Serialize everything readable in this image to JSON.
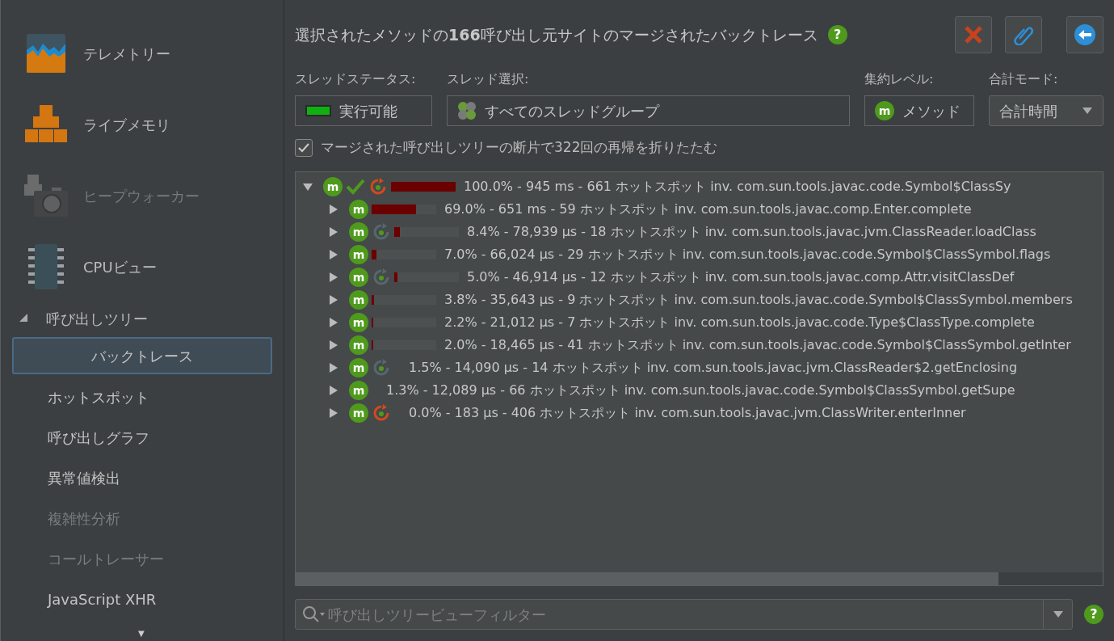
{
  "sidebar": {
    "modules": [
      {
        "kind": "telemetry",
        "label": "テレメトリー",
        "disabled": false
      },
      {
        "kind": "memory",
        "label": "ライブメモリ",
        "disabled": false
      },
      {
        "kind": "heap",
        "label": "ヒープウォーカー",
        "disabled": true
      },
      {
        "kind": "cpu",
        "label": "CPUビュー",
        "disabled": false
      }
    ],
    "section": {
      "label": "呼び出しツリー",
      "expanded": true,
      "items": [
        {
          "label": "バックトレース",
          "selected": true,
          "disabled": false
        },
        {
          "label": "ホットスポット",
          "selected": false,
          "disabled": false
        },
        {
          "label": "呼び出しグラフ",
          "selected": false,
          "disabled": false
        },
        {
          "label": "異常値検出",
          "selected": false,
          "disabled": false
        },
        {
          "label": "複雑性分析",
          "selected": false,
          "disabled": true
        },
        {
          "label": "コールトレーサー",
          "selected": false,
          "disabled": true
        },
        {
          "label": "JavaScript XHR",
          "selected": false,
          "disabled": false
        }
      ]
    },
    "more_arrow": "▼"
  },
  "header": {
    "title": "選択されたメソッドの**166**呼び出し元サイトのマージされたバックトレース",
    "help": "?"
  },
  "filters": [
    {
      "kind": "status",
      "label": "スレッドステータス:",
      "value": "実行可能"
    },
    {
      "kind": "threads",
      "label": "スレッド選択:",
      "value": "すべてのスレッドグループ"
    },
    {
      "kind": "level",
      "label": "集約レベル:",
      "icon": "m",
      "value": "メソッド"
    },
    {
      "kind": "mode",
      "label": "合計モード:",
      "value": "合計時間"
    }
  ],
  "collapse_recursion": {
    "label": "マージされた呼び出しツリーの断片で322回の再帰を折りたたむ",
    "checked": true
  },
  "tree": {
    "root": {
      "expanded": true,
      "checked": true,
      "recursion": true,
      "recursion_hot": true,
      "icon": "m",
      "level": 1.0,
      "text": "100.0% - 945 ms - 661 ホットスポット inv. com.sun.tools.javac.code.Symbol$ClassSy",
      "children": [
        {
          "expanded": false,
          "recursion": false,
          "icon": "m",
          "level": 0.69,
          "text": "69.0% - 651 ms - 59 ホットスポット inv. com.sun.tools.javac.comp.Enter.complete"
        },
        {
          "expanded": false,
          "recursion": true,
          "recursion_hot": false,
          "icon": "m",
          "level": 0.084,
          "text": "8.4% - 78,939 µs - 18 ホットスポット inv. com.sun.tools.javac.jvm.ClassReader.loadClass"
        },
        {
          "expanded": false,
          "recursion": false,
          "icon": "m",
          "level": 0.07,
          "text": "7.0% - 66,024 µs - 29 ホットスポット inv. com.sun.tools.javac.code.Symbol$ClassSymbol.flags"
        },
        {
          "expanded": false,
          "recursion": true,
          "recursion_hot": false,
          "icon": "m",
          "level": 0.05,
          "text": "5.0% - 46,914 µs - 12 ホットスポット inv. com.sun.tools.javac.comp.Attr.visitClassDef"
        },
        {
          "expanded": false,
          "recursion": false,
          "icon": "m",
          "level": 0.038,
          "text": "3.8% - 35,643 µs - 9 ホットスポット inv. com.sun.tools.javac.code.Symbol$ClassSymbol.members"
        },
        {
          "expanded": false,
          "recursion": false,
          "icon": "m",
          "level": 0.022,
          "text": "2.2% - 21,012 µs - 7 ホットスポット inv. com.sun.tools.javac.code.Type$ClassType.complete"
        },
        {
          "expanded": false,
          "recursion": false,
          "icon": "m",
          "level": 0.02,
          "text": "2.0% - 18,465 µs - 41 ホットスポット inv. com.sun.tools.javac.code.Symbol$ClassSymbol.getInter"
        },
        {
          "expanded": false,
          "recursion": true,
          "recursion_hot": false,
          "icon": "m",
          "text": "1.5% - 14,090 µs - 14 ホットスポット inv. com.sun.tools.javac.jvm.ClassReader$2.getEnclosing"
        },
        {
          "expanded": false,
          "recursion": false,
          "icon": "m",
          "text": "1.3% - 12,089 µs - 66 ホットスポット inv. com.sun.tools.javac.code.Symbol$ClassSymbol.getSupe"
        },
        {
          "expanded": false,
          "recursion": true,
          "recursion_hot": true,
          "icon": "m",
          "text": "0.0% - 183 µs - 406 ホットスポット inv. com.sun.tools.javac.jvm.ClassWriter.enterInner"
        }
      ]
    }
  },
  "filter_field": {
    "placeholder": "呼び出しツリービューフィルター"
  },
  "footer_help": "?"
}
